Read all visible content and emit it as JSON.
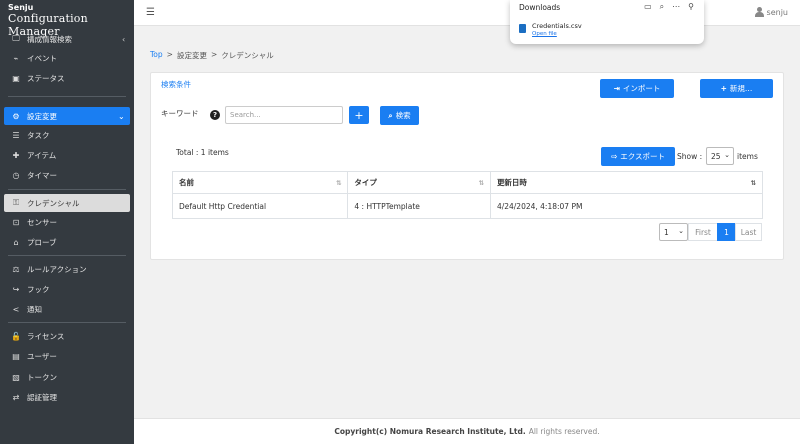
{
  "brand": {
    "line1": "Senju",
    "line2": "Configuration Manager"
  },
  "sidebar": {
    "items": [
      {
        "icon": "monitor-search-icon",
        "glyph": "🖵",
        "label": "構成情報検索",
        "chevron": "‹"
      },
      {
        "icon": "pulse-icon",
        "glyph": "⌁",
        "label": "イベント"
      },
      {
        "icon": "status-icon",
        "glyph": "▣",
        "label": "ステータス"
      },
      {
        "icon": "settings-change-icon",
        "glyph": "⚙",
        "label": "設定変更",
        "chevron": "⌄"
      },
      {
        "icon": "task-list-icon",
        "glyph": "☰",
        "label": "タスク"
      },
      {
        "icon": "puzzle-icon",
        "glyph": "✚",
        "label": "アイテム"
      },
      {
        "icon": "clock-icon",
        "glyph": "◷",
        "label": "タイマー"
      },
      {
        "icon": "key-icon",
        "glyph": "⚿",
        "label": "クレデンシャル"
      },
      {
        "icon": "sensor-icon",
        "glyph": "⊡",
        "label": "センサー"
      },
      {
        "icon": "probe-icon",
        "glyph": "⌂",
        "label": "プローブ"
      },
      {
        "icon": "rule-action-icon",
        "glyph": "⚖",
        "label": "ルールアクション"
      },
      {
        "icon": "hook-icon",
        "glyph": "↪",
        "label": "フック"
      },
      {
        "icon": "share-icon",
        "glyph": "<",
        "label": "通知"
      },
      {
        "icon": "lock-icon",
        "glyph": "🔓",
        "label": "ライセンス"
      },
      {
        "icon": "user-book-icon",
        "glyph": "▤",
        "label": "ユーザー"
      },
      {
        "icon": "token-icon",
        "glyph": "▧",
        "label": "トークン"
      },
      {
        "icon": "auth-exchange-icon",
        "glyph": "⇄",
        "label": "認証管理"
      }
    ]
  },
  "topbar": {
    "menu_icon": "☰",
    "user": "senju"
  },
  "downloads": {
    "title": "Downloads",
    "icons": [
      "folder-icon",
      "search-icon",
      "more-icon",
      "pin-icon"
    ],
    "icon_glyphs": [
      "▭",
      "⌕",
      "⋯",
      "⚲"
    ],
    "file_name": "Credentials.csv",
    "open_label": "Open file"
  },
  "breadcrumb": {
    "top": "Top",
    "sep1": ">",
    "item1": "設定変更",
    "sep2": ">",
    "item2": "クレデンシャル"
  },
  "search": {
    "section_title": "検索条件",
    "keyword_label": "キーワード",
    "help": "?",
    "placeholder": "Search...",
    "add_icon": "+",
    "search_icon": "⌕",
    "search_label": "検索"
  },
  "actions": {
    "import_icon": "⇥",
    "import_label": "インポート",
    "new_icon": "+",
    "new_label": "新規…",
    "export_icon": "⇨",
    "export_label": "エクスポート"
  },
  "list": {
    "total": "Total : 1 items",
    "show_label": "Show :",
    "page_size": "25",
    "items_label": "items",
    "columns": [
      "名前",
      "タイプ",
      "更新日時"
    ],
    "sort_icons": [
      "⇅",
      "⇅",
      "⇅"
    ],
    "rows": [
      [
        "Default Http Credential",
        "4 : HTTPTemplate",
        "4/24/2024, 4:18:07 PM"
      ]
    ]
  },
  "pagination": {
    "page_select": "1",
    "first": "First",
    "current": "1",
    "last": "Last"
  },
  "footer": {
    "copyright": "Copyright(c) Nomura Research Institute, Ltd.",
    "rights": "All rights reserved."
  },
  "colors": {
    "accent": "#1a7ef2",
    "sidebar_bg": "#343a40"
  }
}
